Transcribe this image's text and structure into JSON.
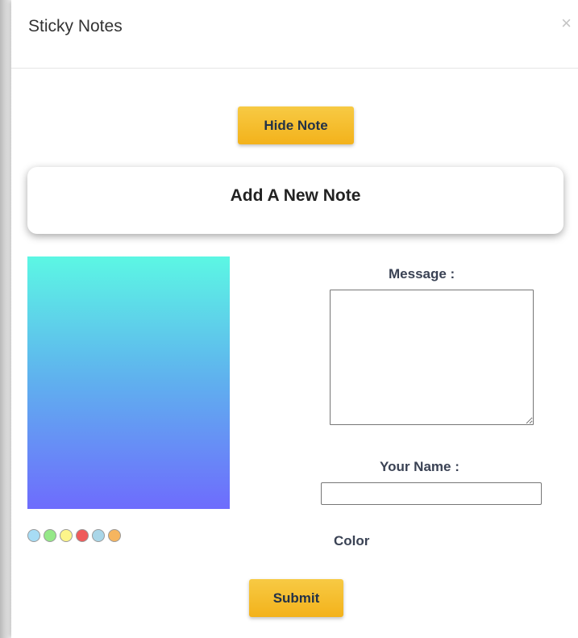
{
  "modal": {
    "title": "Sticky Notes",
    "close_symbol": "×"
  },
  "toolbar": {
    "hide_label": "Hide Note"
  },
  "card": {
    "title": "Add A New Note"
  },
  "preview": {
    "gradient_colors": [
      "#5cf7e4",
      "#5fb2ee",
      "#6e6cfd"
    ]
  },
  "swatches": [
    {
      "name": "light-blue",
      "color": "#a7dcf5"
    },
    {
      "name": "light-green",
      "color": "#95e888"
    },
    {
      "name": "light-yellow",
      "color": "#fdf58a"
    },
    {
      "name": "red",
      "color": "#ef5a5a"
    },
    {
      "name": "pale-blue",
      "color": "#a9d6e8"
    },
    {
      "name": "orange",
      "color": "#f6b55f"
    }
  ],
  "form": {
    "message_label": "Message :",
    "message_value": "",
    "name_label": "Your Name :",
    "name_value": "",
    "color_label": "Color",
    "submit_label": "Submit"
  },
  "colors": {
    "button_yellow": "#f5be2f",
    "button_text": "#233247"
  }
}
